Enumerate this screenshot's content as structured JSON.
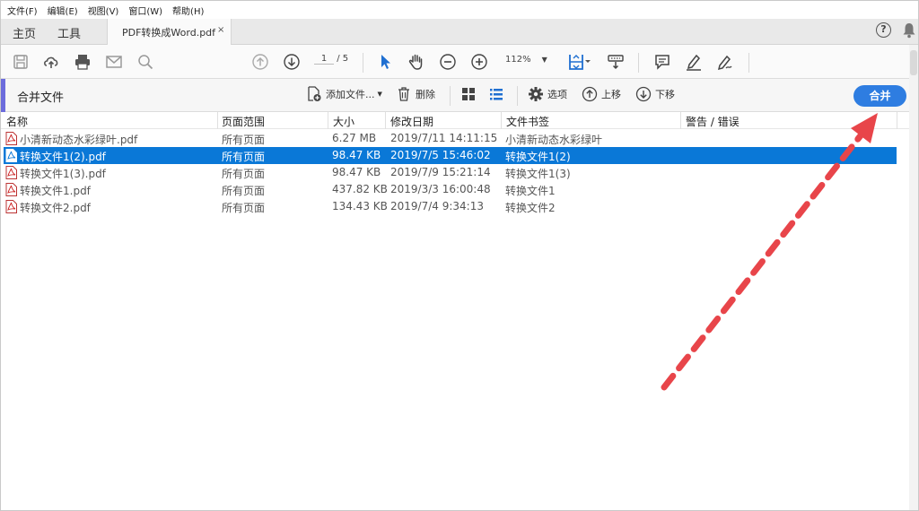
{
  "menu": [
    "文件(F)",
    "编辑(E)",
    "视图(V)",
    "窗口(W)",
    "帮助(H)"
  ],
  "tabs": {
    "home": "主页",
    "tools": "工具",
    "document": "PDF转换成Word.pdf",
    "close": "×"
  },
  "toolbar": {
    "page_current": "1",
    "page_total": "/ 5",
    "zoom": "112%",
    "icons": [
      "save-icon",
      "upload-icon",
      "print-icon",
      "mail-icon",
      "search-zoom-icon",
      "page-up-icon",
      "page-down-icon",
      "select-cursor-icon",
      "hand-icon",
      "zoom-out-icon",
      "zoom-in-icon",
      "fit-icon",
      "keyboard-icon",
      "comment-icon",
      "highlight-pen-icon",
      "sign-icon"
    ]
  },
  "combine": {
    "title": "合并文件",
    "add_files": "添加文件...",
    "delete": "删除",
    "options": "选项",
    "move_up": "上移",
    "move_down": "下移",
    "merge": "合并"
  },
  "table": {
    "columns": [
      "名称",
      "页面范围",
      "大小",
      "修改日期",
      "文件书签",
      "警告 / 错误"
    ],
    "rows": [
      {
        "name": "小清新动态水彩绿叶.pdf",
        "range": "所有页面",
        "size": "6.27 MB",
        "date": "2019/7/11 14:11:15",
        "bookmark": "小清新动态水彩绿叶",
        "selected": false
      },
      {
        "name": "转换文件1(2).pdf",
        "range": "所有页面",
        "size": "98.47 KB",
        "date": "2019/7/5 15:46:02",
        "bookmark": "转换文件1(2)",
        "selected": true
      },
      {
        "name": "转换文件1(3).pdf",
        "range": "所有页面",
        "size": "98.47 KB",
        "date": "2019/7/9 15:21:14",
        "bookmark": "转换文件1(3)",
        "selected": false
      },
      {
        "name": "转换文件1.pdf",
        "range": "所有页面",
        "size": "437.82 KB",
        "date": "2019/3/3 16:00:48",
        "bookmark": "转换文件1",
        "selected": false
      },
      {
        "name": "转换文件2.pdf",
        "range": "所有页面",
        "size": "134.43 KB",
        "date": "2019/7/4 9:34:13",
        "bookmark": "转换文件2",
        "selected": false
      }
    ]
  },
  "colors": {
    "accent": "#2e7de1",
    "selection": "#0a78d7",
    "arrow": "#e8454a",
    "side_accent": "#6c6cdc"
  }
}
